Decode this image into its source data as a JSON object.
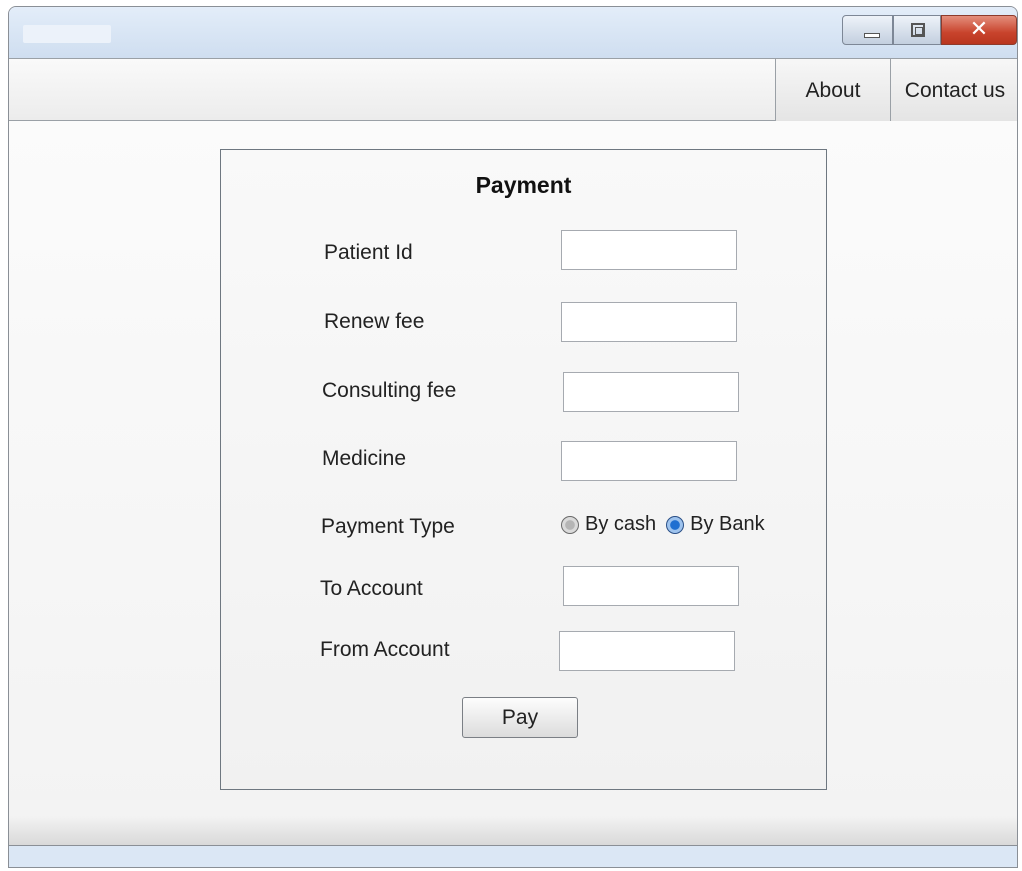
{
  "window": {
    "buttons": {
      "minimize": "minimize-icon",
      "maximize": "maximize-icon",
      "close": "close-icon"
    }
  },
  "menu": {
    "items": [
      {
        "label": "About"
      },
      {
        "label": "Contact us"
      }
    ]
  },
  "form": {
    "title": "Payment",
    "fields": [
      {
        "label": "Patient Id",
        "value": ""
      },
      {
        "label": "Renew fee",
        "value": ""
      },
      {
        "label": "Consulting fee",
        "value": ""
      },
      {
        "label": "Medicine",
        "value": ""
      }
    ],
    "payment_type": {
      "label": "Payment Type",
      "options": [
        {
          "label": "By cash",
          "selected": false
        },
        {
          "label": "By Bank",
          "selected": true
        }
      ]
    },
    "to_account": {
      "label": "To Account",
      "value": ""
    },
    "from_account": {
      "label": "From Account",
      "value": ""
    },
    "submit_label": "Pay"
  },
  "colors": {
    "radio_selected": "#1f6fd1",
    "close_button": "#c8432c",
    "titlebar": "#dbe7f5"
  }
}
